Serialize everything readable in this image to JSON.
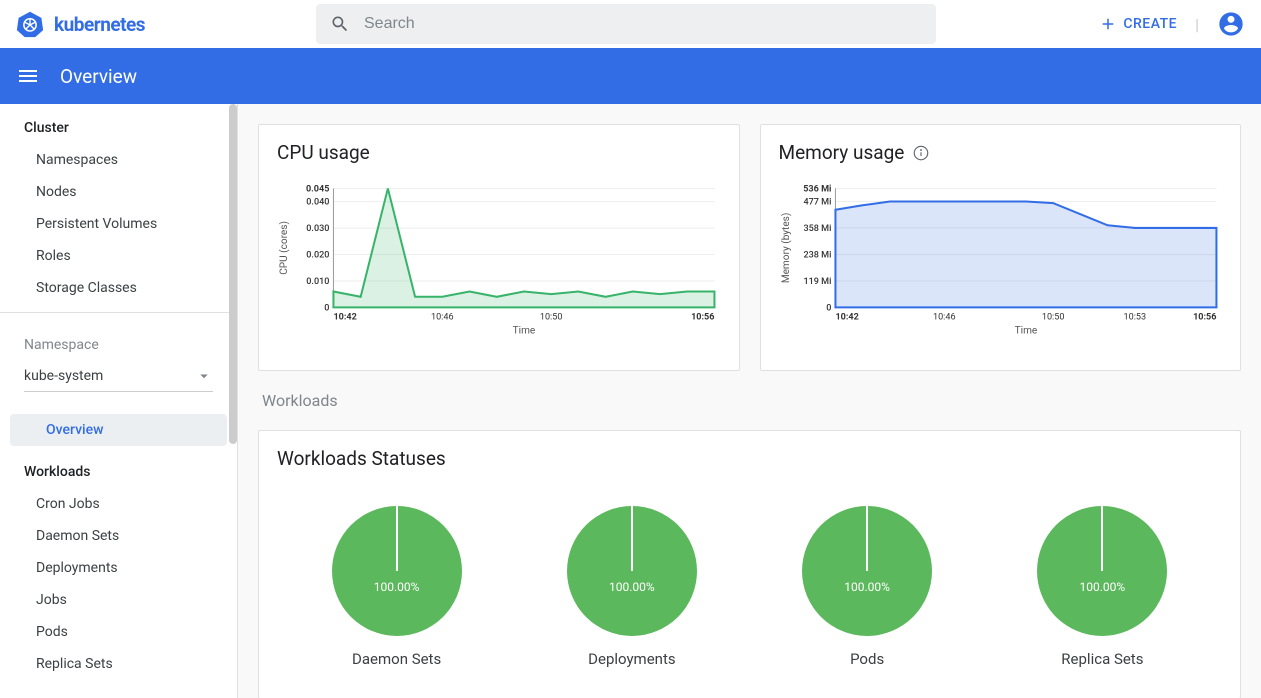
{
  "brand": "kubernetes",
  "search": {
    "placeholder": "Search"
  },
  "top": {
    "create": "CREATE"
  },
  "page_title": "Overview",
  "sidebar": {
    "cluster_label": "Cluster",
    "cluster_items": [
      "Namespaces",
      "Nodes",
      "Persistent Volumes",
      "Roles",
      "Storage Classes"
    ],
    "namespace_label": "Namespace",
    "namespace_value": "kube-system",
    "overview": "Overview",
    "workloads_label": "Workloads",
    "workload_items": [
      "Cron Jobs",
      "Daemon Sets",
      "Deployments",
      "Jobs",
      "Pods",
      "Replica Sets"
    ]
  },
  "cards": {
    "cpu_title": "CPU usage",
    "mem_title": "Memory usage"
  },
  "section_workloads": "Workloads",
  "status_title": "Workloads Statuses",
  "statuses": [
    {
      "pct": "100.00%",
      "label": "Daemon Sets"
    },
    {
      "pct": "100.00%",
      "label": "Deployments"
    },
    {
      "pct": "100.00%",
      "label": "Pods"
    },
    {
      "pct": "100.00%",
      "label": "Replica Sets"
    }
  ],
  "chart_data": [
    {
      "type": "area",
      "title": "CPU usage",
      "xlabel": "Time",
      "ylabel": "CPU (cores)",
      "ylim": [
        0,
        0.045
      ],
      "yticks": [
        0,
        0.01,
        0.02,
        0.03,
        0.04,
        0.045
      ],
      "x": [
        "10:42",
        "10:43",
        "10:44",
        "10:45",
        "10:46",
        "10:47",
        "10:48",
        "10:49",
        "10:50",
        "10:51",
        "10:52",
        "10:53",
        "10:54",
        "10:55",
        "10:56"
      ],
      "xticks_shown": [
        "10:42",
        "10:46",
        "10:50",
        "10:56"
      ],
      "values": [
        0.006,
        0.004,
        0.045,
        0.004,
        0.004,
        0.006,
        0.004,
        0.006,
        0.005,
        0.006,
        0.004,
        0.006,
        0.005,
        0.006,
        0.006
      ],
      "color": "#38b36a"
    },
    {
      "type": "area",
      "title": "Memory usage",
      "xlabel": "Time",
      "ylabel": "Memory (bytes)",
      "ylim": [
        0,
        536
      ],
      "yunit": "Mi",
      "yticks": [
        0,
        119,
        238,
        358,
        477,
        536
      ],
      "x": [
        "10:42",
        "10:43",
        "10:44",
        "10:45",
        "10:46",
        "10:47",
        "10:48",
        "10:49",
        "10:50",
        "10:51",
        "10:52",
        "10:53",
        "10:54",
        "10:55",
        "10:56"
      ],
      "xticks_shown": [
        "10:42",
        "10:46",
        "10:50",
        "10:53",
        "10:56"
      ],
      "values": [
        440,
        460,
        477,
        477,
        477,
        477,
        477,
        477,
        470,
        420,
        370,
        358,
        358,
        358,
        358
      ],
      "color": "#326de6"
    }
  ]
}
